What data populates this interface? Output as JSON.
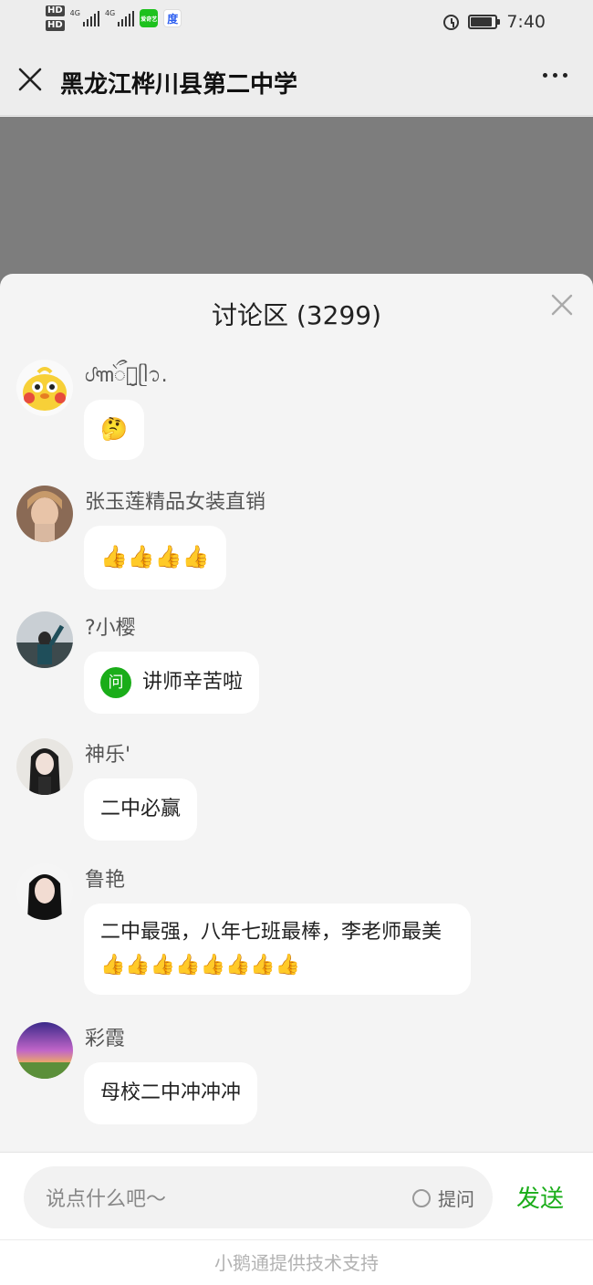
{
  "status_bar": {
    "hd1": "HD",
    "hd2": "HD",
    "net1": "4G",
    "net2": "4G",
    "app1": "爱奇艺",
    "app2": "度",
    "time": "7:40"
  },
  "navbar": {
    "title": "黑龙江桦川县第二中学"
  },
  "sheet": {
    "title": "讨论区 (3299)"
  },
  "messages": [
    {
      "name": "ᦔ꧑ᭂ茶̮ᥫ᭡.",
      "text": "🤔"
    },
    {
      "name": "张玉莲精品女装直销",
      "text": "👍👍👍👍"
    },
    {
      "name": "?小樱",
      "badge": "问",
      "text": "讲师辛苦啦"
    },
    {
      "name": "神乐'",
      "text": "二中必赢"
    },
    {
      "name": "鲁艳",
      "text": "二中最强，八年七班最棒，李老师最美👍👍👍👍👍👍👍👍"
    },
    {
      "name": "彩霞",
      "text": "母校二中冲冲冲"
    }
  ],
  "input": {
    "placeholder": "说点什么吧～",
    "ask_label": "提问",
    "send_label": "发送"
  },
  "footer": {
    "text": "小鹅通提供技术支持"
  },
  "colors": {
    "accent": "#1aad19",
    "overlay": "#7d7d7d",
    "sheet_bg": "#f4f4f4"
  }
}
